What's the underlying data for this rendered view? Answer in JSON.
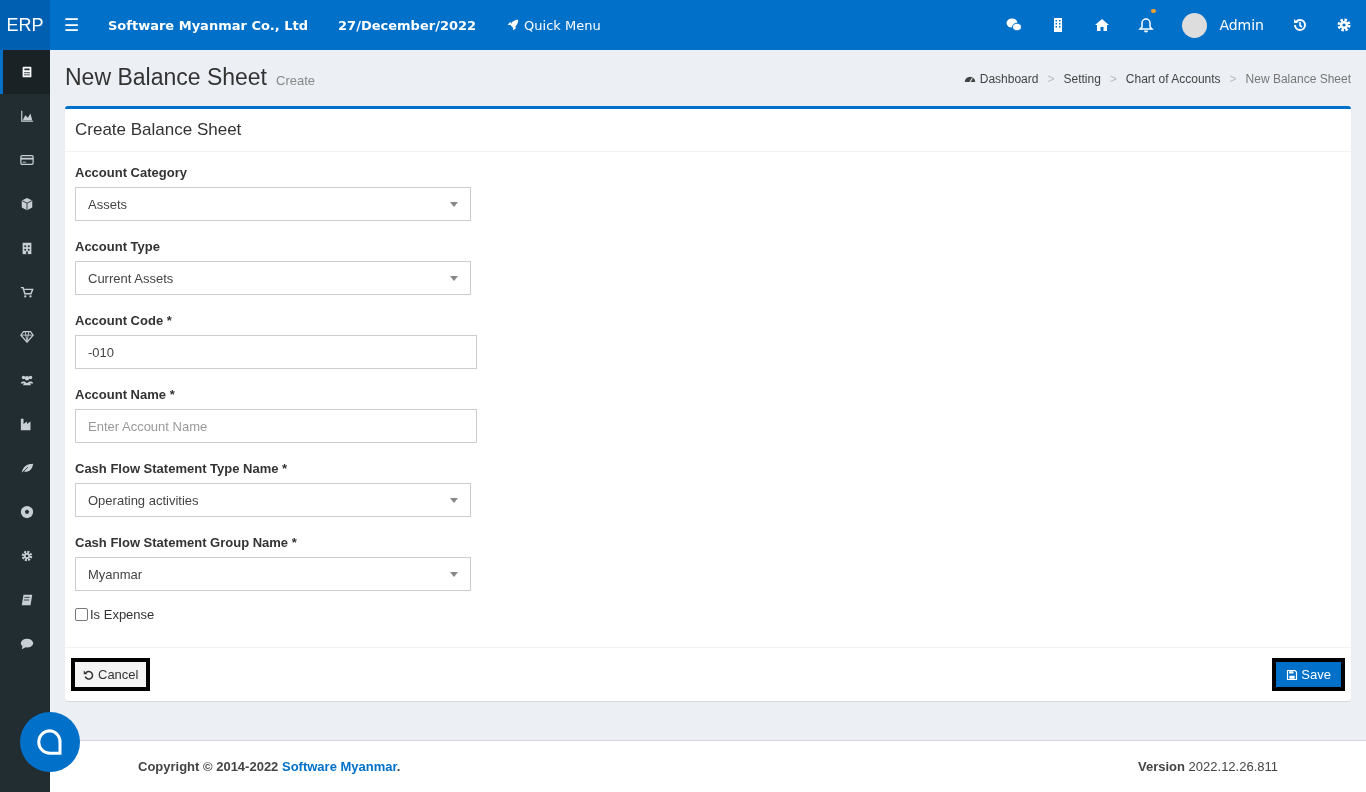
{
  "topbar": {
    "logo": "ERP",
    "menu_icon": "☰",
    "company": "Software Myanmar Co., Ltd",
    "date": "27/December/2022",
    "quick_menu": "Quick Menu",
    "notification_dot": true,
    "user": "Admin"
  },
  "sidebar": {
    "items": [
      {
        "selected": true
      },
      {
        "selected": false
      },
      {
        "selected": false
      },
      {
        "selected": false
      },
      {
        "selected": false
      },
      {
        "selected": false
      },
      {
        "selected": false
      },
      {
        "selected": false
      },
      {
        "selected": false
      },
      {
        "selected": false
      },
      {
        "selected": false
      },
      {
        "selected": false
      },
      {
        "selected": false
      },
      {
        "selected": false
      }
    ]
  },
  "page": {
    "title": "New Balance Sheet",
    "subtitle": "Create"
  },
  "breadcrumb": [
    {
      "label": "Dashboard"
    },
    {
      "label": "Setting",
      "separator": ">"
    },
    {
      "label": "Chart of Accounts",
      "separator": ">"
    },
    {
      "label": "New Balance Sheet",
      "separator": ">"
    }
  ],
  "card": {
    "title": "Create Balance Sheet",
    "fields": [
      {
        "kind": "select",
        "label": "Account Category",
        "value": "Assets"
      },
      {
        "kind": "select",
        "label": "Account Type",
        "value": "Current Assets"
      },
      {
        "kind": "text",
        "label": "Account Code *",
        "value": "-010"
      },
      {
        "kind": "text",
        "label": "Account Name *",
        "placeholder": "Enter Account Name"
      },
      {
        "kind": "select",
        "label": "Cash Flow Statement Type Name *",
        "value": "Operating activities"
      },
      {
        "kind": "select",
        "label": "Cash Flow Statement Group Name *",
        "value": "Myanmar"
      }
    ],
    "checkbox": {
      "label": "Is Expense",
      "checked": false
    },
    "buttons": [
      {
        "kind": "cancel",
        "label": "Cancel"
      },
      {
        "kind": "save",
        "label": "Save"
      }
    ]
  },
  "footer": {
    "copyright": "Copyright © 2014-2022 ",
    "link": "Software Myanmar",
    "after": ".",
    "version": "**Version** 2022.12.26.811"
  }
}
